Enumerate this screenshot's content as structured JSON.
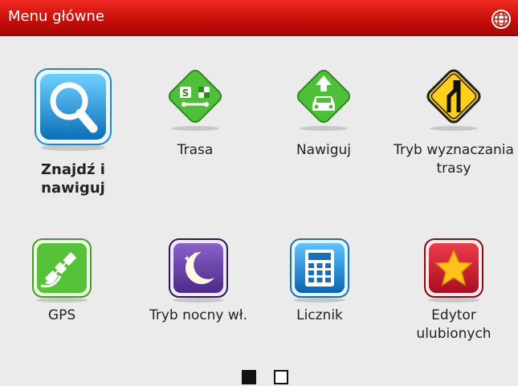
{
  "header": {
    "title": "Menu główne",
    "globe_icon": "globe-icon"
  },
  "tiles": [
    {
      "label": "Znajdź i nawiguj",
      "icon": "search-icon"
    },
    {
      "label": "Trasa",
      "icon": "route-icon"
    },
    {
      "label": "Nawiguj",
      "icon": "navigate-car-icon"
    },
    {
      "label": "Tryb wyznaczania trasy",
      "icon": "road-sign-icon"
    },
    {
      "label": "GPS",
      "icon": "satellite-icon"
    },
    {
      "label": "Tryb nocny wł.",
      "icon": "moon-icon"
    },
    {
      "label": "Licznik",
      "icon": "calculator-icon"
    },
    {
      "label": "Edytor ulubionych",
      "icon": "star-icon"
    }
  ],
  "pagination": {
    "pages": 2,
    "current": 1
  },
  "colors": {
    "titlebar": "#c80f0a",
    "background": "#ebebeb"
  }
}
